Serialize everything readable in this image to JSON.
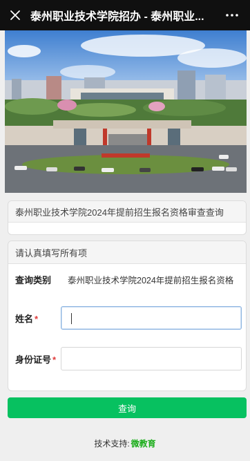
{
  "topbar": {
    "title": "泰州职业技术学院招办 - 泰州职业...",
    "close_icon": "close-icon",
    "more_icon": "more-icon"
  },
  "banner": {
    "alt": "campus-aerial-photo"
  },
  "notice_panel": {
    "title": "泰州职业技术学院2024年提前招生报名资格审查查询"
  },
  "form_panel": {
    "title": "请认真填写所有项",
    "fields": [
      {
        "label": "查询类别",
        "required": false,
        "value": "泰州职业技术学院2024年提前招生报名资格"
      },
      {
        "label": "姓名",
        "required": true,
        "value": ""
      },
      {
        "label": "身份证号",
        "required": true,
        "value": ""
      }
    ],
    "required_mark": "*"
  },
  "submit": {
    "label": "查询"
  },
  "footer": {
    "prefix": "技术支持:",
    "brand": "微教育"
  },
  "colors": {
    "accent": "#07c160",
    "brand": "#1aad19",
    "required": "#e03a3a"
  }
}
